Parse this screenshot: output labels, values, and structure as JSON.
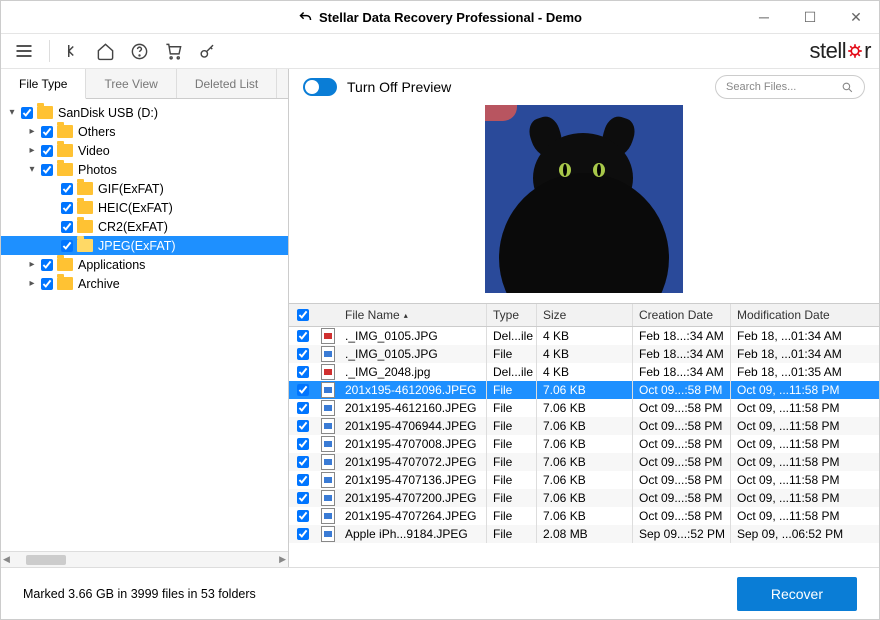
{
  "window": {
    "title": "Stellar Data Recovery Professional - Demo"
  },
  "brand": {
    "pre": "stell",
    "post": "r"
  },
  "tabs": [
    {
      "label": "File Type",
      "active": true
    },
    {
      "label": "Tree View",
      "active": false
    },
    {
      "label": "Deleted List",
      "active": false
    }
  ],
  "tree": [
    {
      "depth": 0,
      "expand": "open",
      "checked": true,
      "label": "SanDisk USB (D:)"
    },
    {
      "depth": 1,
      "expand": "closed",
      "checked": true,
      "label": "Others"
    },
    {
      "depth": 1,
      "expand": "closed",
      "checked": true,
      "label": "Video"
    },
    {
      "depth": 1,
      "expand": "open",
      "checked": true,
      "label": "Photos"
    },
    {
      "depth": 2,
      "expand": "none",
      "checked": true,
      "label": "GIF(ExFAT)"
    },
    {
      "depth": 2,
      "expand": "none",
      "checked": true,
      "label": "HEIC(ExFAT)"
    },
    {
      "depth": 2,
      "expand": "none",
      "checked": true,
      "label": "CR2(ExFAT)"
    },
    {
      "depth": 2,
      "expand": "none",
      "checked": true,
      "label": "JPEG(ExFAT)",
      "selected": true,
      "open": true
    },
    {
      "depth": 1,
      "expand": "closed",
      "checked": true,
      "label": "Applications"
    },
    {
      "depth": 1,
      "expand": "closed",
      "checked": true,
      "label": "Archive"
    }
  ],
  "preview": {
    "toggle_label": "Turn Off Preview",
    "on": true
  },
  "search": {
    "placeholder": "Search Files..."
  },
  "grid": {
    "headers": {
      "name": "File Name",
      "type": "Type",
      "size": "Size",
      "cdate": "Creation Date",
      "mdate": "Modification Date"
    },
    "rows": [
      {
        "ck": true,
        "del": true,
        "name": "._IMG_0105.JPG",
        "type": "Del...ile",
        "size": "4 KB",
        "cdate": "Feb 18...:34 AM",
        "mdate": "Feb 18, ...01:34 AM"
      },
      {
        "ck": true,
        "del": false,
        "name": "._IMG_0105.JPG",
        "type": "File",
        "size": "4 KB",
        "cdate": "Feb 18...:34 AM",
        "mdate": "Feb 18, ...01:34 AM"
      },
      {
        "ck": true,
        "del": true,
        "name": "._IMG_2048.jpg",
        "type": "Del...ile",
        "size": "4 KB",
        "cdate": "Feb 18...:34 AM",
        "mdate": "Feb 18, ...01:35 AM"
      },
      {
        "ck": true,
        "del": false,
        "name": "201x195-4612096.JPEG",
        "type": "File",
        "size": "7.06 KB",
        "cdate": "Oct 09...:58 PM",
        "mdate": "Oct 09, ...11:58 PM",
        "selected": true
      },
      {
        "ck": true,
        "del": false,
        "name": "201x195-4612160.JPEG",
        "type": "File",
        "size": "7.06 KB",
        "cdate": "Oct 09...:58 PM",
        "mdate": "Oct 09, ...11:58 PM"
      },
      {
        "ck": true,
        "del": false,
        "name": "201x195-4706944.JPEG",
        "type": "File",
        "size": "7.06 KB",
        "cdate": "Oct 09...:58 PM",
        "mdate": "Oct 09, ...11:58 PM"
      },
      {
        "ck": true,
        "del": false,
        "name": "201x195-4707008.JPEG",
        "type": "File",
        "size": "7.06 KB",
        "cdate": "Oct 09...:58 PM",
        "mdate": "Oct 09, ...11:58 PM"
      },
      {
        "ck": true,
        "del": false,
        "name": "201x195-4707072.JPEG",
        "type": "File",
        "size": "7.06 KB",
        "cdate": "Oct 09...:58 PM",
        "mdate": "Oct 09, ...11:58 PM"
      },
      {
        "ck": true,
        "del": false,
        "name": "201x195-4707136.JPEG",
        "type": "File",
        "size": "7.06 KB",
        "cdate": "Oct 09...:58 PM",
        "mdate": "Oct 09, ...11:58 PM"
      },
      {
        "ck": true,
        "del": false,
        "name": "201x195-4707200.JPEG",
        "type": "File",
        "size": "7.06 KB",
        "cdate": "Oct 09...:58 PM",
        "mdate": "Oct 09, ...11:58 PM"
      },
      {
        "ck": true,
        "del": false,
        "name": "201x195-4707264.JPEG",
        "type": "File",
        "size": "7.06 KB",
        "cdate": "Oct 09...:58 PM",
        "mdate": "Oct 09, ...11:58 PM"
      },
      {
        "ck": true,
        "del": false,
        "name": "Apple iPh...9184.JPEG",
        "type": "File",
        "size": "2.08 MB",
        "cdate": "Sep 09...:52 PM",
        "mdate": "Sep 09, ...06:52 PM"
      }
    ]
  },
  "footer": {
    "status": "Marked 3.66 GB in 3999 files in 53 folders",
    "recover": "Recover"
  }
}
